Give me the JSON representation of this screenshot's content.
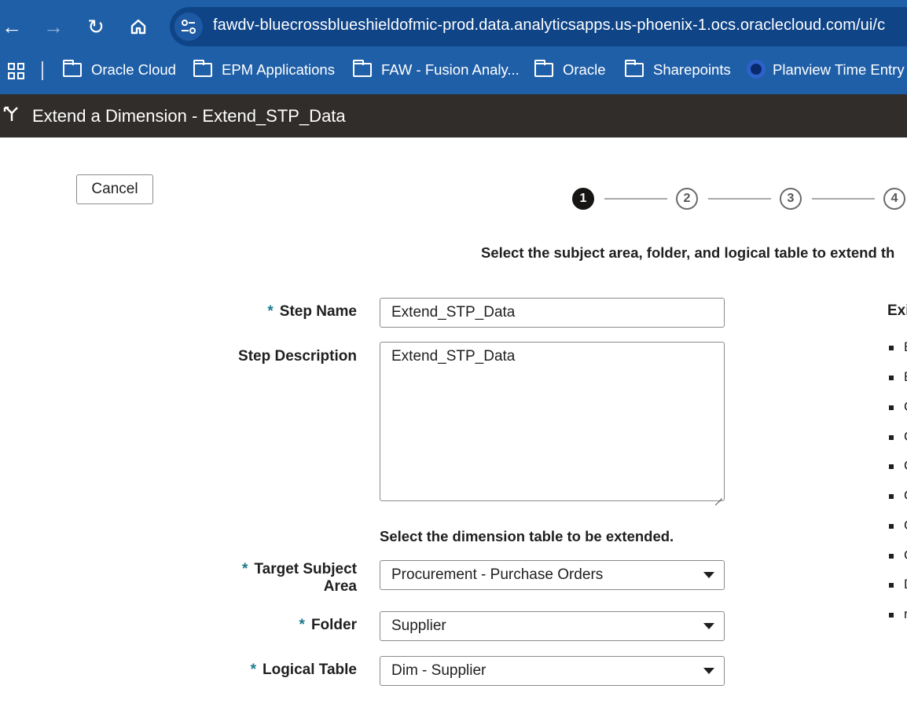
{
  "browser": {
    "url": "fawdv-bluecrossblueshieldofmic-prod.data.analyticsapps.us-phoenix-1.ocs.oraclecloud.com/ui/c",
    "bookmarks": [
      {
        "label": "Oracle Cloud",
        "icon": "folder-icon"
      },
      {
        "label": "EPM Applications",
        "icon": "folder-icon"
      },
      {
        "label": "FAW - Fusion Analy...",
        "icon": "folder-icon"
      },
      {
        "label": "Oracle",
        "icon": "folder-icon"
      },
      {
        "label": "Sharepoints",
        "icon": "folder-icon"
      },
      {
        "label": "Planview Time Entry",
        "icon": "planview-icon"
      }
    ]
  },
  "header": {
    "title": "Extend a Dimension - Extend_STP_Data"
  },
  "wizard": {
    "cancel_label": "Cancel",
    "steps": [
      "1",
      "2",
      "3",
      "4"
    ],
    "active_step": 1,
    "instruction": "Select the subject area, folder, and logical table to extend th"
  },
  "form": {
    "required_mark": "*",
    "step_name": {
      "label": "Step Name",
      "value": "Extend_STP_Data"
    },
    "step_description": {
      "label": "Step Description",
      "value": "Extend_STP_Data"
    },
    "section_heading": "Select the dimension table to be extended.",
    "target_subject_area": {
      "label_line1": "Target Subject",
      "label_line2": "Area",
      "value": "Procurement - Purchase Orders"
    },
    "folder": {
      "label": "Folder",
      "value": "Supplier"
    },
    "logical_table": {
      "label": "Logical Table",
      "value": "Dim - Supplier"
    }
  },
  "side_panel": {
    "title": "Exi",
    "items": [
      "E",
      "E",
      "C",
      "C",
      "C",
      "C",
      "C",
      "C",
      "D",
      "r"
    ]
  },
  "colors": {
    "browser_chrome": "#1f5fa8",
    "title_bar": "#312d2a",
    "active_step": "#161513",
    "required_asterisk": "#1a7a8c"
  }
}
